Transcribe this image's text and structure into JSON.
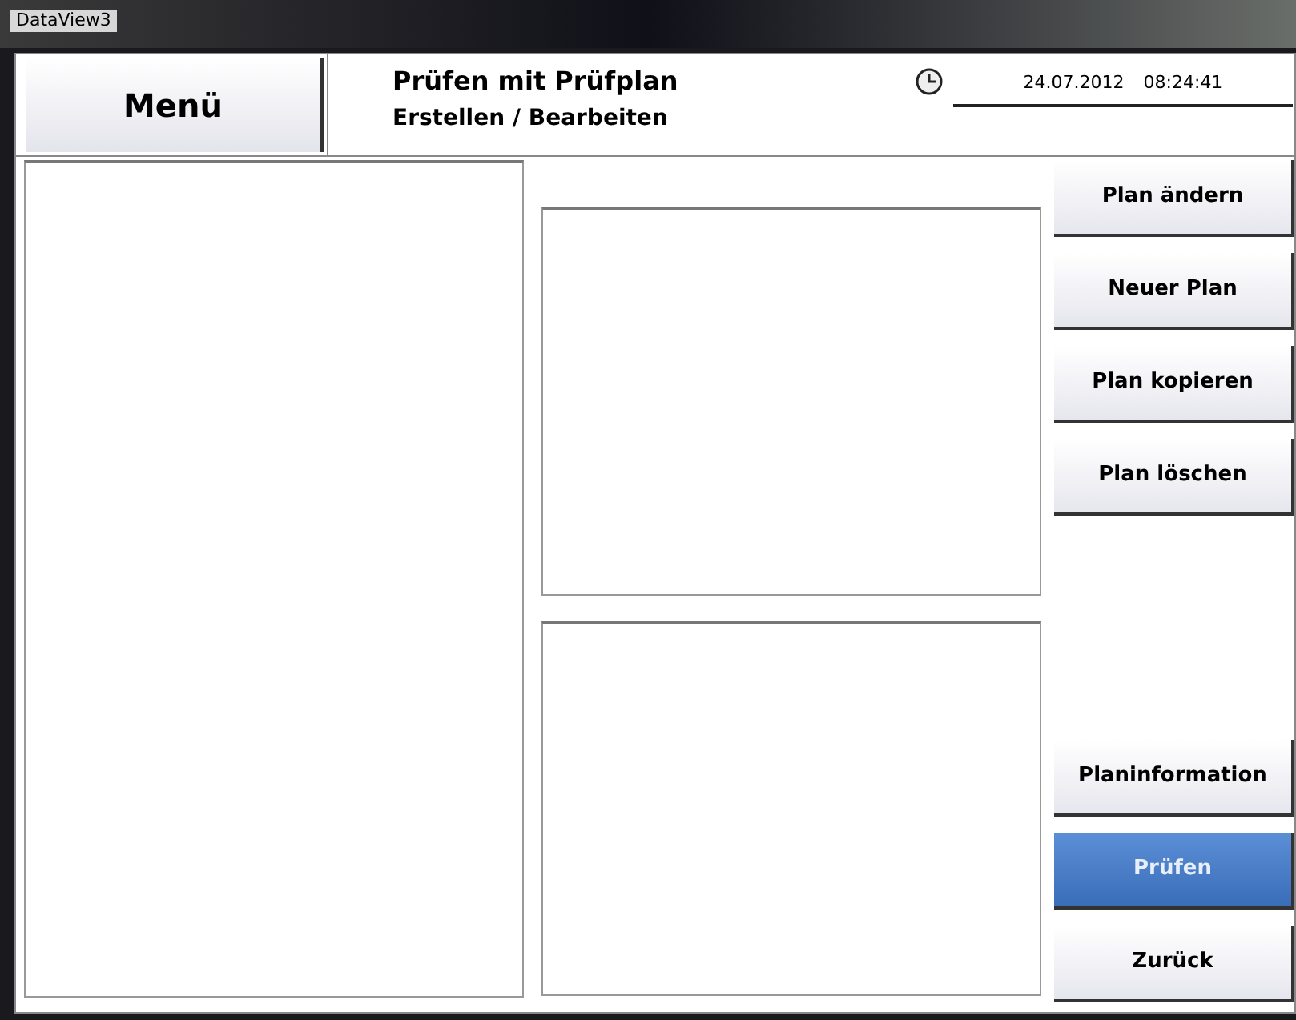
{
  "window": {
    "title": "DataView3"
  },
  "header": {
    "menu_button": "Menü",
    "title": "Prüfen mit Prüfplan",
    "subtitle": "Erstellen / Bearbeiten",
    "date": "24.07.2012",
    "time": "08:24:41"
  },
  "actions_top": [
    {
      "label": "Plan ändern",
      "highlighted": false
    },
    {
      "label": "Neuer Plan",
      "highlighted": false
    },
    {
      "label": "Plan kopieren",
      "highlighted": false
    },
    {
      "label": "Plan löschen",
      "highlighted": false
    }
  ],
  "actions_bottom": [
    {
      "label": "Planinformation",
      "highlighted": false
    },
    {
      "label": "Prüfen",
      "highlighted": true
    },
    {
      "label": "Zurück",
      "highlighted": false
    }
  ]
}
